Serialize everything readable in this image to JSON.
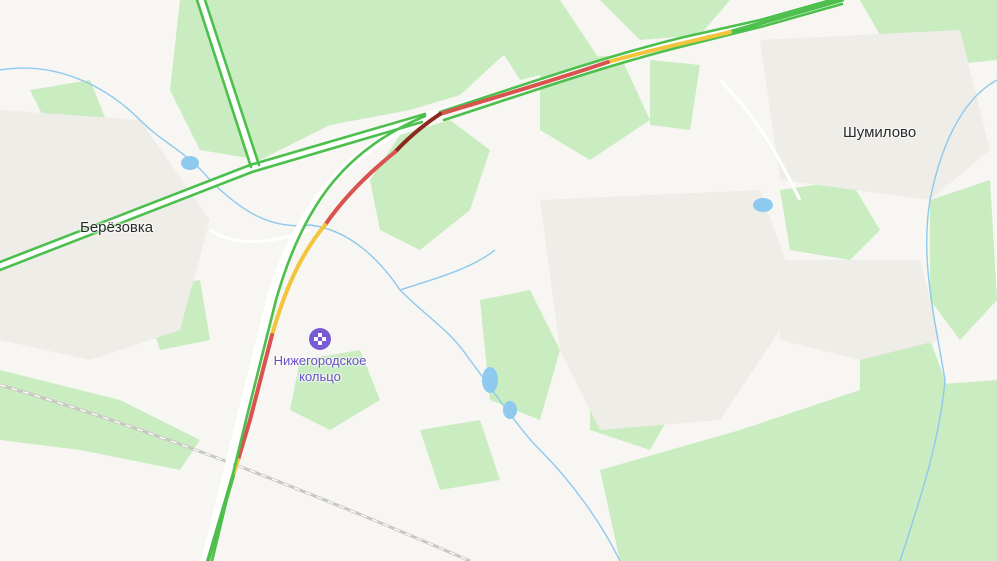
{
  "map": {
    "places": [
      {
        "key": "berezovka",
        "name": "Берёзовка"
      },
      {
        "key": "shumilovo",
        "name": "Шумилово"
      }
    ],
    "poi": {
      "line1": "Нижегородское",
      "line2": "кольцо",
      "icon": "checkered-flag-icon",
      "color": "#7a5bd6"
    },
    "traffic_colors": {
      "free": "#4cbf4c",
      "slow": "#f2c53d",
      "jam": "#d9534f",
      "heavy": "#8b2a1e"
    },
    "colors": {
      "background": "#f7f6f2",
      "forest": "#c9ecc0",
      "water": "#8ec9ee",
      "residential": "#efede8"
    }
  }
}
